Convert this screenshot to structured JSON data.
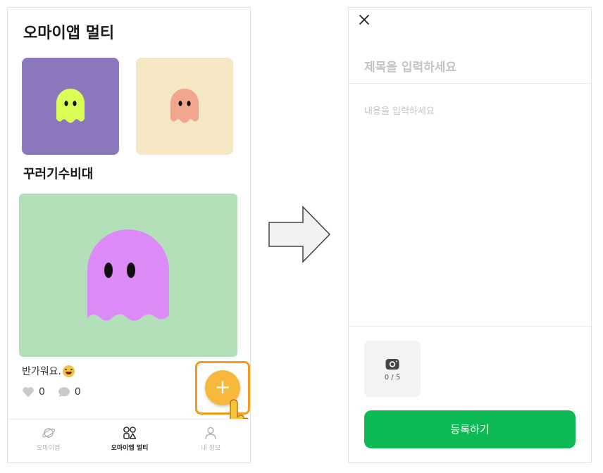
{
  "left_screen": {
    "app_title": "오마이앱 멀티",
    "thumbnails": [
      {
        "background": "#8b78bd",
        "ghost_color": "#d9ff56",
        "icon": "ghost-icon"
      },
      {
        "background": "#f5e6c4",
        "ghost_color": "#f0a58c",
        "icon": "ghost-icon"
      }
    ],
    "section_title": "꾸러기수비대",
    "post": {
      "image_background": "#b3e0b8",
      "ghost_color": "#dc8af8",
      "caption": "반가워요.",
      "caption_emoji": "grinning-face-icon",
      "likes": "0",
      "comments": "0"
    },
    "fab": {
      "label": "+",
      "color": "#f7b93c",
      "highlight_color": "#f39a1f"
    },
    "bottom_nav": [
      {
        "label": "오마이앱",
        "icon": "planet-icon",
        "active": false
      },
      {
        "label": "오마이앱 멀티",
        "icon": "shapes-icon",
        "active": true
      },
      {
        "label": "내 정보",
        "icon": "person-icon",
        "active": false
      }
    ]
  },
  "right_screen": {
    "close_icon": "close-icon",
    "title_placeholder": "제목을 입력하세요",
    "content_placeholder": "내용을 입력하세요",
    "photo_count": "0 / 5",
    "photo_icon": "camera-icon",
    "submit_label": "등록하기",
    "submit_color": "#0eba54"
  }
}
